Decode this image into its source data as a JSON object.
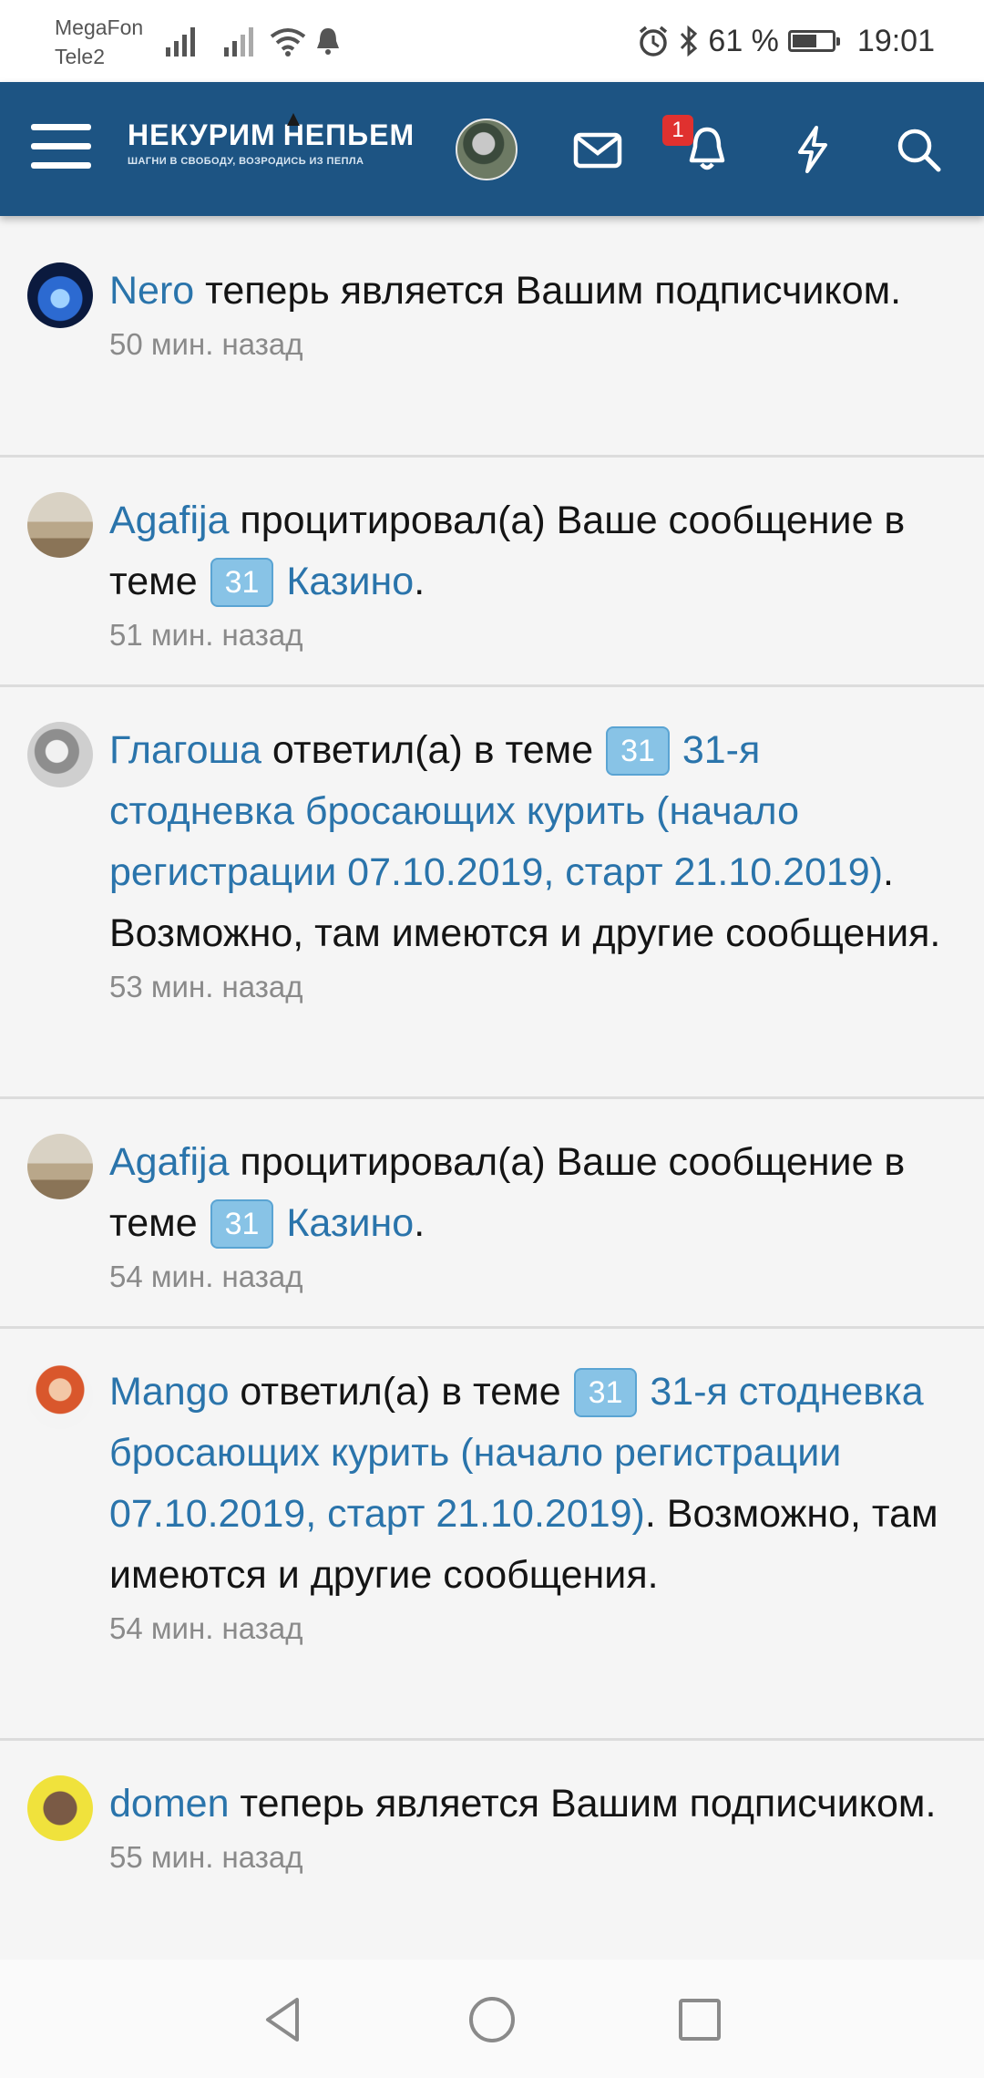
{
  "status_bar": {
    "carrier_1": "MegaFon",
    "carrier_2": "Tele2",
    "battery_text": "61 %",
    "battery_level": 0.61,
    "time": "19:01"
  },
  "header": {
    "logo_title_left": "НЕКУРИМ",
    "logo_title_right": "НЕПЬЕМ",
    "logo_subtitle": "ШАГНИ В СВОБОДУ, ВОЗРОДИСЬ ИЗ ПЕПЛА",
    "notification_count": "1",
    "brand_color": "#1d5483",
    "badge_color": "#e0312f"
  },
  "notifications": [
    {
      "user": "Nero",
      "text_1": " теперь является Вашим подписчиком.",
      "time": "50 мин. назад"
    },
    {
      "user": "Agafija",
      "text_1": " процитировал(а) Ваше сообщение в теме ",
      "tag": "31",
      "thread": "Казино",
      "text_2": ".",
      "time": "51 мин. назад"
    },
    {
      "user": "Глагоша",
      "text_1": " ответил(а) в теме ",
      "tag": "31",
      "thread": "31-я стодневка бросающих курить (начало регистрации 07.10.2019, старт 21.10.2019)",
      "text_2": ". Возможно, там имеются и другие сообщения.",
      "time": "53 мин. назад"
    },
    {
      "user": "Agafija",
      "text_1": " процитировал(а) Ваше сообщение в теме ",
      "tag": "31",
      "thread": "Казино",
      "text_2": ".",
      "time": "54 мин. назад"
    },
    {
      "user": "Mango",
      "text_1": " ответил(а) в теме ",
      "tag": "31",
      "thread": "31-я стодневка бросающих курить (начало регистрации 07.10.2019, старт 21.10.2019)",
      "text_2": ". Возможно, там имеются и другие сообщения.",
      "time": "54 мин. назад"
    },
    {
      "user": "domen",
      "text_1": " теперь является Вашим подписчиком.",
      "time": "55 мин. назад"
    }
  ],
  "icons": {
    "menu": "hamburger-icon",
    "mail": "envelope-icon",
    "alerts": "bell-icon",
    "activity": "lightning-icon",
    "search": "search-icon",
    "back": "back-triangle-icon",
    "home": "home-circle-icon",
    "recents": "recents-square-icon"
  }
}
